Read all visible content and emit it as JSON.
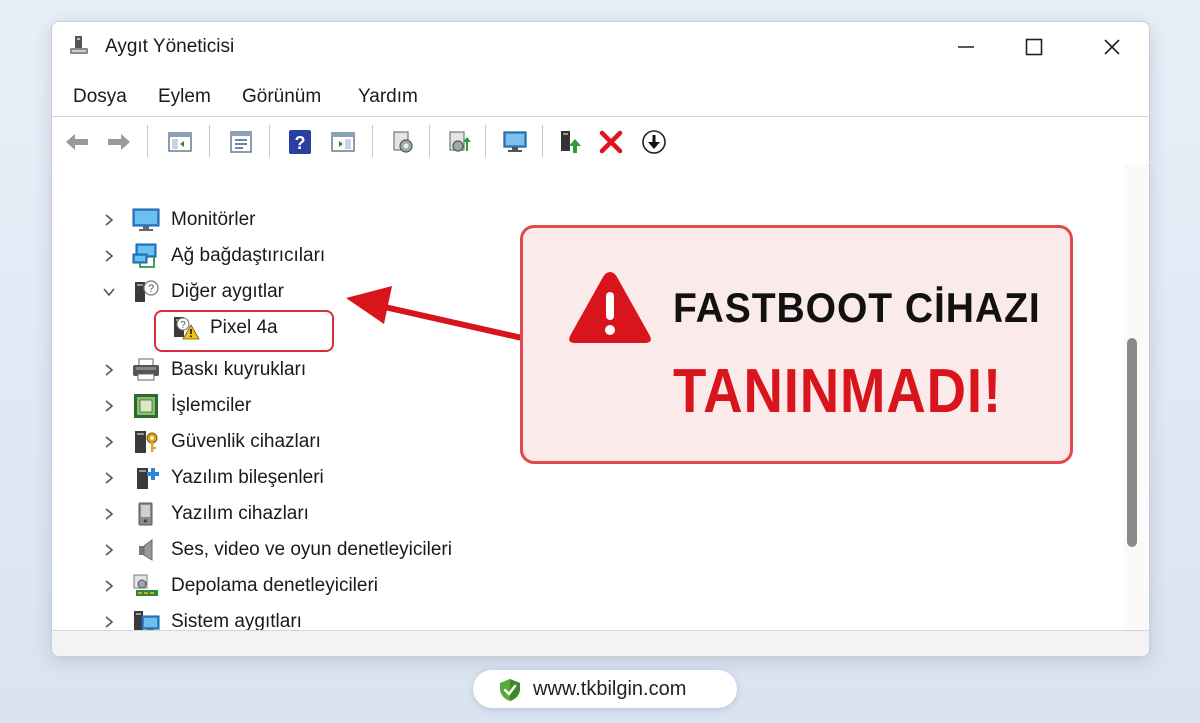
{
  "window": {
    "title": "Aygıt Yöneticisi"
  },
  "menu": [
    "Dosya",
    "Eylem",
    "Görünüm",
    "Yardım"
  ],
  "toolbar_icons": [
    "back-arrow-icon",
    "forward-arrow-icon",
    "show-hide-console-tree-icon",
    "properties-icon",
    "help-icon",
    "action-pane-icon",
    "update-driver-icon",
    "scan-hardware-icon",
    "display-adapter-icon",
    "enable-device-icon",
    "uninstall-device-icon",
    "download-driver-icon"
  ],
  "tree": [
    {
      "label": "Monitörler",
      "icon": "monitor-icon",
      "expanded": false
    },
    {
      "label": "Ağ bağdaştırıcıları",
      "icon": "network-adapter-icon",
      "expanded": false
    },
    {
      "label": "Diğer aygıtlar",
      "icon": "unknown-device-icon",
      "expanded": true
    },
    {
      "label": "Pixel 4a",
      "icon": "warning-device-icon",
      "child": true,
      "highlighted": true
    },
    {
      "label": "Baskı kuyrukları",
      "icon": "printer-icon",
      "expanded": false
    },
    {
      "label": "İşlemciler",
      "icon": "processor-icon",
      "expanded": false
    },
    {
      "label": "Güvenlik cihazları",
      "icon": "security-device-icon",
      "expanded": false
    },
    {
      "label": "Yazılım bileşenleri",
      "icon": "software-component-icon",
      "expanded": false
    },
    {
      "label": "Yazılım cihazları",
      "icon": "software-device-icon",
      "expanded": false
    },
    {
      "label": "Ses, video ve oyun denetleyicileri",
      "icon": "speaker-icon",
      "expanded": false
    },
    {
      "label": "Depolama denetleyicileri",
      "icon": "storage-controller-icon",
      "expanded": false
    },
    {
      "label": "Sistem aygıtları",
      "icon": "system-device-icon",
      "expanded": false
    }
  ],
  "callout": {
    "line1": "FASTBOOT CİHAZI",
    "line2": "TANINMADI!"
  },
  "footer": {
    "url": "www.tkbilgin.com"
  },
  "colors": {
    "accent_red": "#d8141d",
    "callout_bg": "#fbeaea",
    "callout_border": "#e14a4a"
  }
}
